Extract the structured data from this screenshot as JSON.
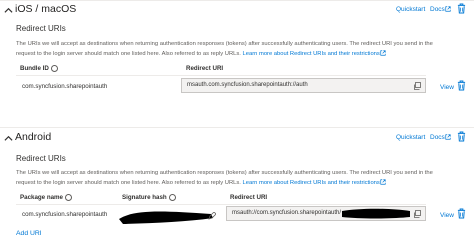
{
  "ios": {
    "title": "iOS / macOS",
    "quickstart": "Quickstart",
    "docs": "Docs",
    "redirect_heading": "Redirect URIs",
    "desc_line1": "The URIs we will accept as destinations when returning authentication responses (tokens) after successfully authenticating users. The redirect URI you send in the",
    "desc_line2": "request to the login server should match one listed here. Also referred to as reply URLs.",
    "learn_more": "Learn more about Redirect URIs and their restrictions",
    "col_bundle": "Bundle ID",
    "col_redirect": "Redirect URI",
    "bundle_value": "com.syncfusion.sharepointauth",
    "redirect_value": "msauth.com.syncfusion.sharepointauth://auth",
    "view": "View"
  },
  "android": {
    "title": "Android",
    "quickstart": "Quickstart",
    "docs": "Docs",
    "redirect_heading": "Redirect URIs",
    "desc_line1": "The URIs we will accept as destinations when returning authentication responses (tokens) after successfully authenticating users. The redirect URI you send in the",
    "desc_line2": "request to the login server should match one listed here. Also referred to as reply URLs.",
    "learn_more": "Learn more about Redirect URIs and their restrictions",
    "col_package": "Package name",
    "col_signature": "Signature hash",
    "col_redirect": "Redirect URI",
    "package_value": "com.syncfusion.sharepointauth",
    "redirect_value": "msauth://com.syncfusion.sharepointauth/",
    "view": "View",
    "add_uri": "Add URI"
  },
  "colors": {
    "accent": "#0078d4",
    "delete": "#0078d4",
    "redaction": "#000000"
  }
}
